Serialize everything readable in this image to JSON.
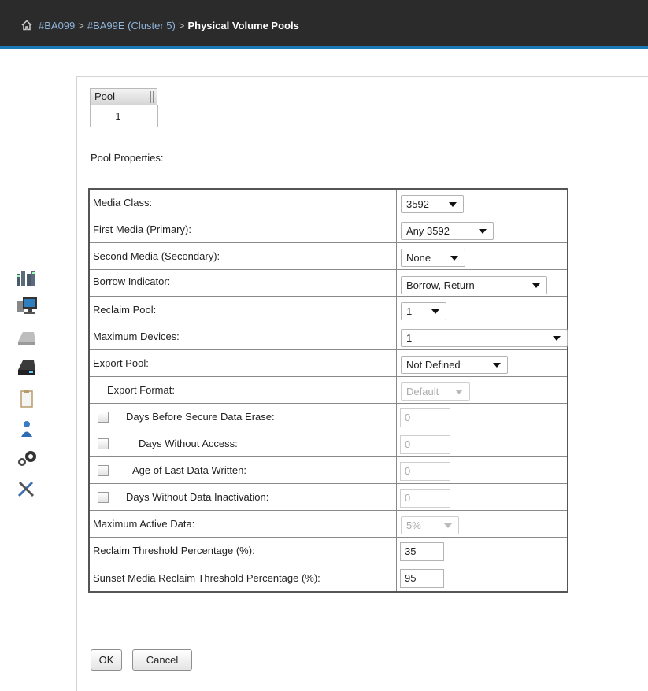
{
  "header": {
    "breadcrumb": [
      {
        "label": "#BA099"
      },
      {
        "label": "#BA99E (Cluster 5)"
      },
      {
        "label": "Physical Volume Pools"
      }
    ],
    "separator": ">",
    "accent_color": "#1b79b8",
    "bar_color": "#2b2b2b"
  },
  "left_nav": {
    "icons": [
      "cluster-icon",
      "monitor-icon",
      "disk-icon",
      "drive-icon",
      "clipboard-icon",
      "user-icon",
      "gears-icon",
      "tools-icon"
    ]
  },
  "pool_grid": {
    "header": "Pool",
    "value": "1"
  },
  "pool_properties": {
    "title": "Pool Properties:",
    "rows": [
      {
        "label": "Media Class:",
        "value": "3592"
      },
      {
        "label": "First Media (Primary):",
        "value": "Any 3592"
      },
      {
        "label": "Second Media (Secondary):",
        "value": "None"
      },
      {
        "label": "Borrow Indicator:",
        "value": "Borrow, Return"
      },
      {
        "label": "Reclaim Pool:",
        "value": "1"
      },
      {
        "label": "Maximum Devices:",
        "value": "1"
      },
      {
        "label": "Export Pool:",
        "value": "Not Defined"
      },
      {
        "label": "Export Format:",
        "value": "Default"
      },
      {
        "label": "Days Before Secure Data Erase:",
        "value": "0"
      },
      {
        "label": "Days Without Access:",
        "value": "0"
      },
      {
        "label": "Age of Last Data Written:",
        "value": "0"
      },
      {
        "label": "Days Without Data Inactivation:",
        "value": "0"
      },
      {
        "label": "Maximum Active Data:",
        "value": "5%"
      },
      {
        "label": "Reclaim Threshold Percentage (%):",
        "value": "35"
      },
      {
        "label": "Sunset Media Reclaim Threshold Percentage (%):",
        "value": "95"
      }
    ]
  },
  "buttons": {
    "ok": "OK",
    "cancel": "Cancel"
  }
}
